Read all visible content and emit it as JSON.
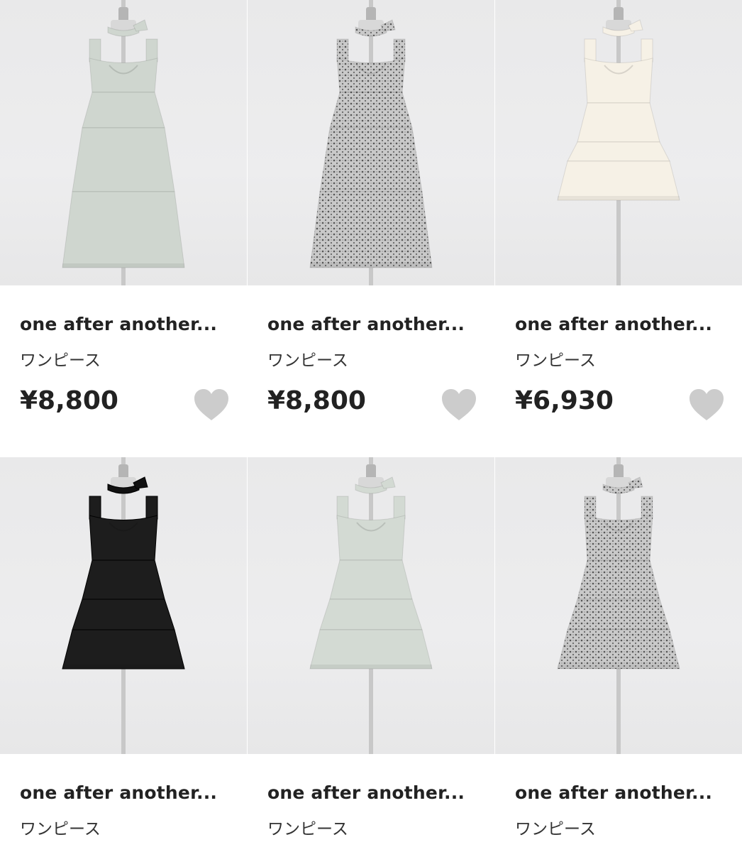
{
  "products": [
    {
      "name": "one after another...",
      "category": "ワンピース",
      "price": "¥8,800",
      "favorite_icon": "heart-icon",
      "color": "#cfd6cf",
      "length": "long",
      "pattern": "plain"
    },
    {
      "name": "one after another...",
      "category": "ワンピース",
      "price": "¥8,800",
      "favorite_icon": "heart-icon",
      "color": "#9a9a9a",
      "length": "long",
      "pattern": "floral"
    },
    {
      "name": "one after another...",
      "category": "ワンピース",
      "price": "¥6,930",
      "favorite_icon": "heart-icon",
      "color": "#f6f1e6",
      "length": "short",
      "pattern": "plain"
    },
    {
      "name": "one after another...",
      "category": "ワンピース",
      "price": "",
      "favorite_icon": "heart-icon",
      "color": "#1d1d1d",
      "length": "short",
      "pattern": "plain"
    },
    {
      "name": "one after another...",
      "category": "ワンピース",
      "price": "",
      "favorite_icon": "heart-icon",
      "color": "#d3dad3",
      "length": "short",
      "pattern": "plain"
    },
    {
      "name": "one after another...",
      "category": "ワンピース",
      "price": "",
      "favorite_icon": "heart-icon",
      "color": "#9c9c9c",
      "length": "short",
      "pattern": "floral"
    }
  ],
  "colors": {
    "heart": "#cccccc",
    "background": "#ffffff",
    "text": "#222222"
  }
}
